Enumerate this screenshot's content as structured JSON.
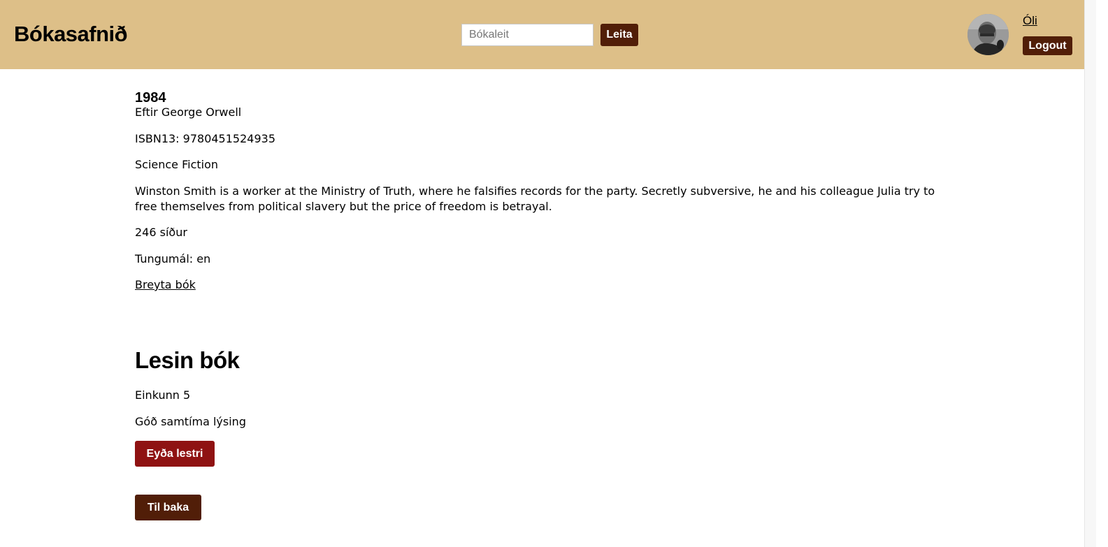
{
  "header": {
    "site_title": "Bókasafnið",
    "search": {
      "placeholder": "Bókaleit",
      "value": "",
      "button_label": "Leita"
    },
    "user": {
      "name": "Óli",
      "logout_label": "Logout"
    }
  },
  "book": {
    "title": "1984",
    "author_line": "Eftir George Orwell",
    "isbn_line": "ISBN13: 9780451524935",
    "genre": "Science Fiction",
    "description": "Winston Smith is a worker at the Ministry of Truth, where he falsifies records for the party. Secretly subversive, he and his colleague Julia try to free themselves from political slavery but the price of freedom is betrayal.",
    "pages_line": "246 síður",
    "language_line": "Tungumál: en",
    "edit_link": "Breyta bók"
  },
  "reading": {
    "heading": "Lesin bók",
    "rating_line": "Einkunn 5",
    "review": "Góð samtíma lýsing",
    "delete_label": "Eyða lestri"
  },
  "back_label": "Til baka",
  "colors": {
    "header_bg": "#ddbf88",
    "primary_button": "#511e08",
    "danger_button": "#8f1212"
  }
}
